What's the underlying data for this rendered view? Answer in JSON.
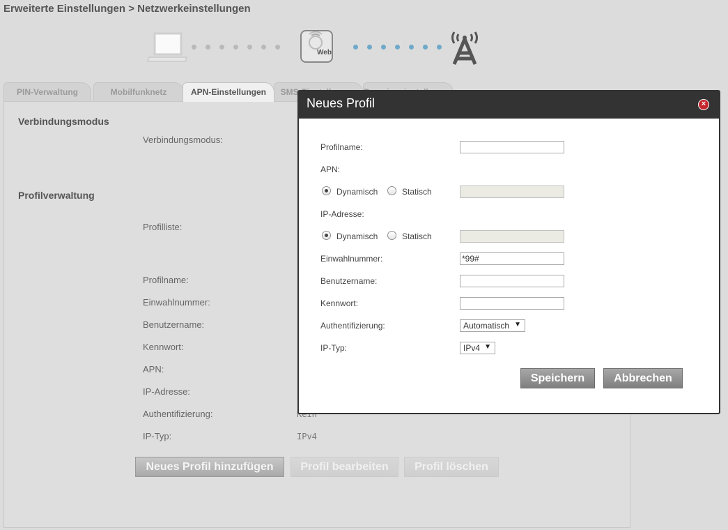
{
  "breadcrumb": "Erweiterte Einstellungen > Netzwerkeinstellungen",
  "diagram": {
    "web_label": "Web",
    "icons": [
      "laptop-icon",
      "web-router-icon",
      "antenna-tower-icon"
    ]
  },
  "tabs": [
    {
      "label": "PIN-Verwaltung",
      "active": false
    },
    {
      "label": "Mobilfunknetz",
      "active": false
    },
    {
      "label": "APN-Einstellungen",
      "active": true
    },
    {
      "label": "SMS-Einstellungen",
      "active": false
    },
    {
      "label": "Roamingeinstellungen",
      "active": false
    }
  ],
  "panel": {
    "section_connection": "Verbindungsmodus",
    "connection_mode_label": "Verbindungsmodus:",
    "section_profile": "Profilverwaltung",
    "profile_list_label": "Profilliste:",
    "fields": {
      "profile_name": "Profilname:",
      "dial_number": "Einwahlnummer:",
      "username": "Benutzername:",
      "password": "Kennwort:",
      "apn": "APN:",
      "ip_address": "IP-Adresse:",
      "authentication": "Authentifizierung:",
      "ip_type": "IP-Typ:"
    },
    "values": {
      "authentication": "Kein",
      "ip_type": "IPv4"
    },
    "buttons": {
      "add": "Neues Profil hinzufügen",
      "edit": "Profil bearbeiten",
      "delete": "Profil löschen"
    }
  },
  "modal": {
    "title": "Neues Profil",
    "profile_name_label": "Profilname:",
    "profile_name_value": "",
    "apn_label": "APN:",
    "dynamic_label": "Dynamisch",
    "static_label": "Statisch",
    "ip_address_label": "IP-Adresse:",
    "dial_number_label": "Einwahlnummer:",
    "dial_number_value": "*99#",
    "username_label": "Benutzername:",
    "password_label": "Kennwort:",
    "authentication_label": "Authentifizierung:",
    "authentication_value": "Automatisch",
    "ip_type_label": "IP-Typ:",
    "ip_type_value": "IPv4",
    "save_label": "Speichern",
    "cancel_label": "Abbrechen"
  }
}
